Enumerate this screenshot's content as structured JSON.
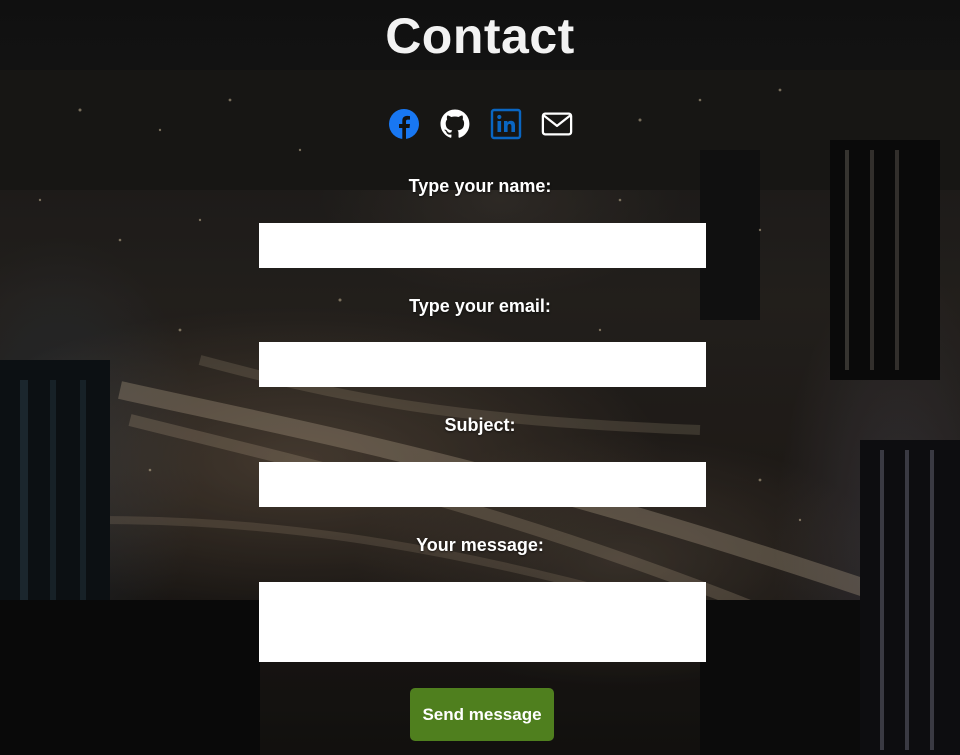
{
  "page": {
    "title": "Contact"
  },
  "social": [
    {
      "name": "facebook-icon",
      "color": "#1877f2"
    },
    {
      "name": "github-icon",
      "color": "#ffffff"
    },
    {
      "name": "linkedin-icon",
      "color": "#0a66c2"
    },
    {
      "name": "mail-icon",
      "color": "#ffffff"
    }
  ],
  "form": {
    "name_label": "Type your name:",
    "name_value": "",
    "email_label": "Type your email:",
    "email_value": "",
    "subject_label": "Subject:",
    "subject_value": "",
    "message_label": "Your message:",
    "message_value": "",
    "send_label": "Send message"
  },
  "colors": {
    "button": "#4f7f1e",
    "text": "#ffffff"
  }
}
